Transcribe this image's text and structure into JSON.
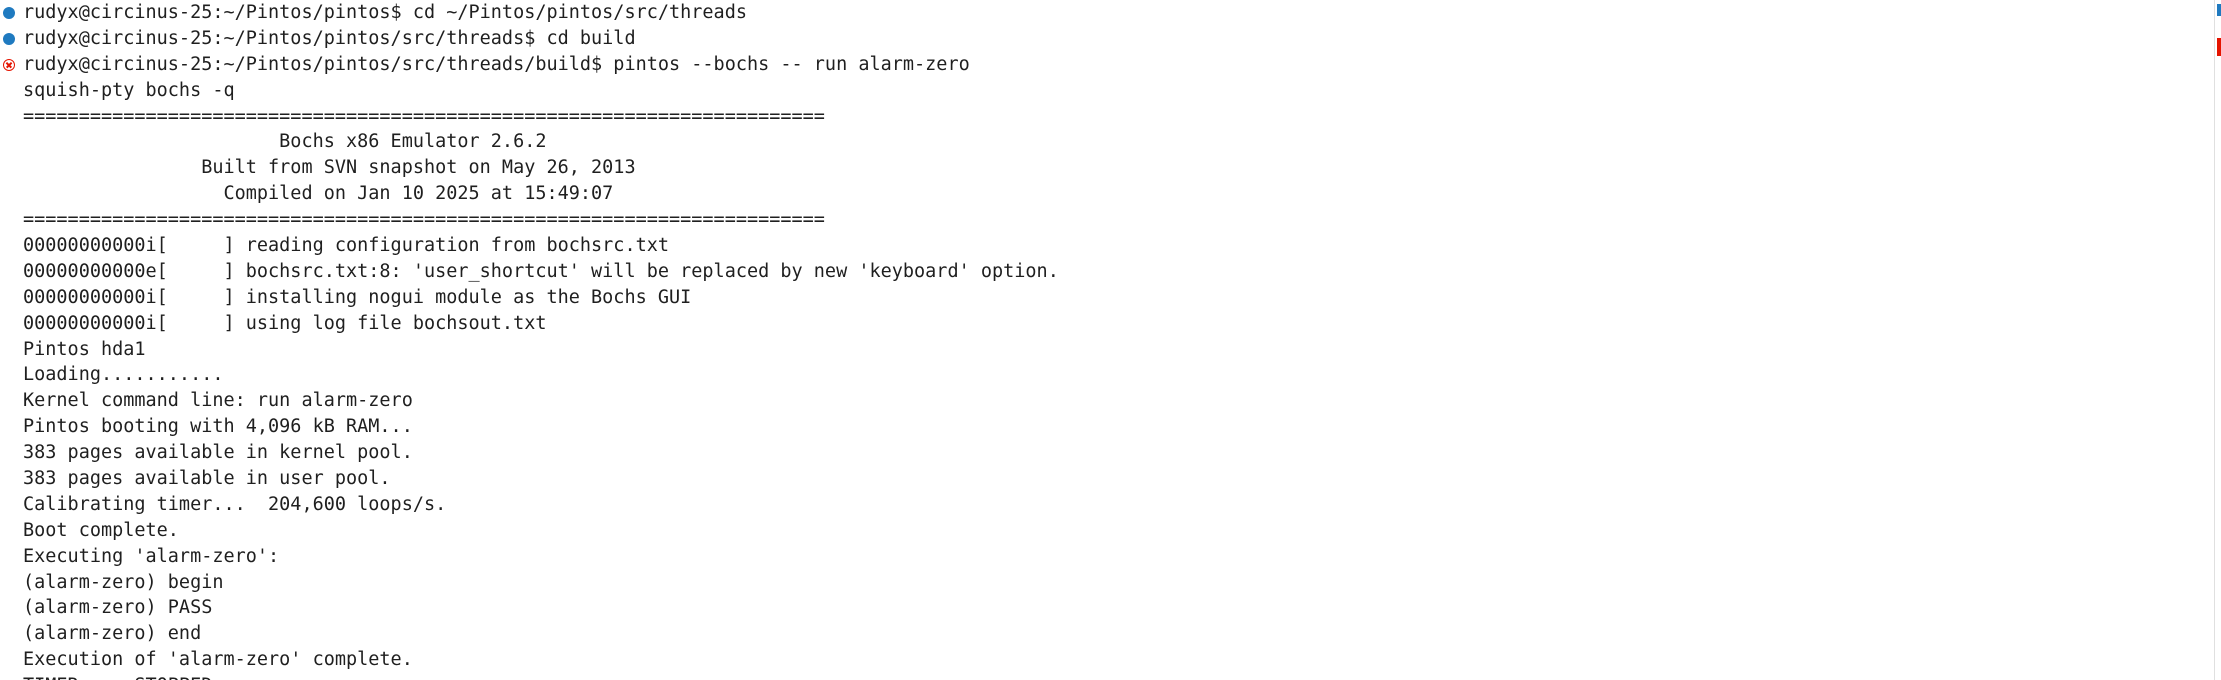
{
  "colors": {
    "background": "#ffffff",
    "text": "#1f1f1f",
    "success_decoration": "#1f7ac0",
    "error_decoration": "#e51400"
  },
  "terminal": {
    "lines": [
      {
        "text": "rudyx@circinus-25:~/Pintos/pintos$ cd ~/Pintos/pintos/src/threads",
        "decoration": "success"
      },
      {
        "text": "rudyx@circinus-25:~/Pintos/pintos/src/threads$ cd build",
        "decoration": "success"
      },
      {
        "text": "rudyx@circinus-25:~/Pintos/pintos/src/threads/build$ pintos --bochs -- run alarm-zero",
        "decoration": "error"
      },
      {
        "text": "squish-pty bochs -q"
      },
      {
        "text": "========================================================================"
      },
      {
        "text": "                       Bochs x86 Emulator 2.6.2"
      },
      {
        "text": "                Built from SVN snapshot on May 26, 2013"
      },
      {
        "text": "                  Compiled on Jan 10 2025 at 15:49:07"
      },
      {
        "text": "========================================================================"
      },
      {
        "text": "00000000000i[     ] reading configuration from bochsrc.txt"
      },
      {
        "text": "00000000000e[     ] bochsrc.txt:8: 'user_shortcut' will be replaced by new 'keyboard' option."
      },
      {
        "text": "00000000000i[     ] installing nogui module as the Bochs GUI"
      },
      {
        "text": "00000000000i[     ] using log file bochsout.txt"
      },
      {
        "text": "Pintos hda1"
      },
      {
        "text": "Loading..........."
      },
      {
        "text": "Kernel command line: run alarm-zero"
      },
      {
        "text": "Pintos booting with 4,096 kB RAM..."
      },
      {
        "text": "383 pages available in kernel pool."
      },
      {
        "text": "383 pages available in user pool."
      },
      {
        "text": "Calibrating timer...  204,600 loops/s."
      },
      {
        "text": "Boot complete."
      },
      {
        "text": "Executing 'alarm-zero':"
      },
      {
        "text": "(alarm-zero) begin"
      },
      {
        "text": "(alarm-zero) PASS"
      },
      {
        "text": "(alarm-zero) end"
      },
      {
        "text": "Execution of 'alarm-zero' complete."
      },
      {
        "text": "TIMER: ...STOPPED"
      }
    ]
  }
}
